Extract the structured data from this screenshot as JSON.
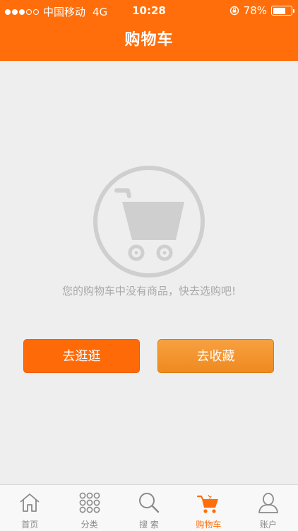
{
  "status_bar": {
    "carrier": "中国移动",
    "network": "4G",
    "time": "10:28",
    "battery_percent": "78%",
    "battery_level": 0.78,
    "signal_filled": 3,
    "signal_total": 5
  },
  "navbar": {
    "title": "购物车"
  },
  "empty_state": {
    "icon": "shopping-cart-icon",
    "message": "您的购物车中没有商品，快去选购吧!"
  },
  "buttons": {
    "go_shopping": "去逛逛",
    "favorites": "去收藏"
  },
  "tabbar": {
    "items": [
      {
        "label": "首页",
        "icon": "home-icon",
        "active": false
      },
      {
        "label": "分类",
        "icon": "grid-icon",
        "active": false
      },
      {
        "label": "搜 索",
        "icon": "search-icon",
        "active": false
      },
      {
        "label": "购物车",
        "icon": "cart-icon",
        "active": true
      },
      {
        "label": "账户",
        "icon": "user-icon",
        "active": false
      }
    ]
  },
  "colors": {
    "brand": "#ff6e0a",
    "secondary_button": "#f39630",
    "background": "#eeeeee",
    "muted_text": "#a9a9a9"
  }
}
